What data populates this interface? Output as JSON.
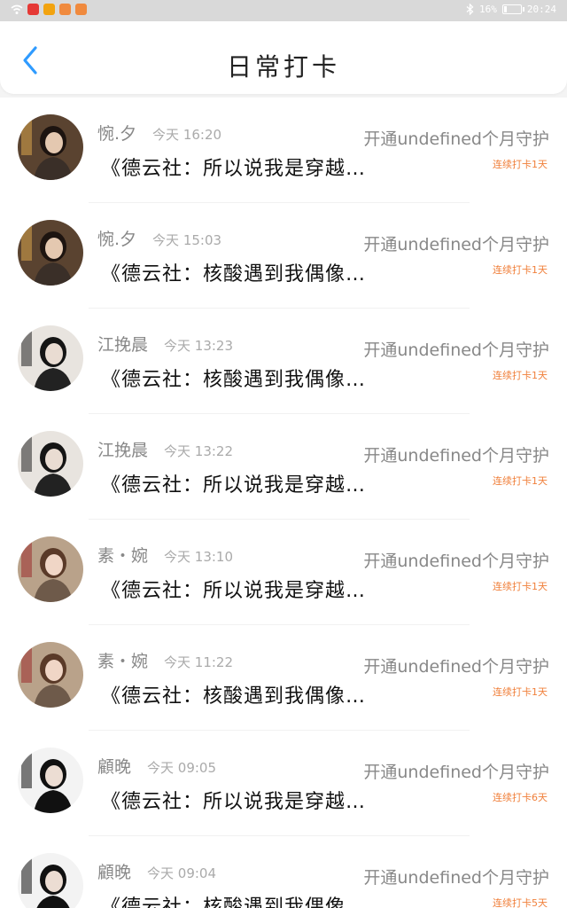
{
  "status_bar": {
    "battery_percent": "16%",
    "battery_level": 0.16,
    "time": "20:24",
    "app_icon_colors": [
      "#e53935",
      "#f2a30f",
      "#f08a3e",
      "#f08a3e"
    ]
  },
  "nav": {
    "back_icon": "chevron-left-icon",
    "title": "日常打卡"
  },
  "records": [
    {
      "name": "惋.夕",
      "time": "今天 16:20",
      "content": "《德云社：所以说我是穿越…",
      "guard": "开通undefined个月守护",
      "streak": "连续打卡1天"
    },
    {
      "name": "惋.夕",
      "time": "今天 15:03",
      "content": "《德云社：核酸遇到我偶像…",
      "guard": "开通undefined个月守护",
      "streak": "连续打卡1天"
    },
    {
      "name": "江挽晨",
      "time": "今天 13:23",
      "content": "《德云社：核酸遇到我偶像…",
      "guard": "开通undefined个月守护",
      "streak": "连续打卡1天"
    },
    {
      "name": "江挽晨",
      "time": "今天 13:22",
      "content": "《德云社：所以说我是穿越…",
      "guard": "开通undefined个月守护",
      "streak": "连续打卡1天"
    },
    {
      "name": "素・婉",
      "time": "今天 13:10",
      "content": "《德云社：所以说我是穿越…",
      "guard": "开通undefined个月守护",
      "streak": "连续打卡1天"
    },
    {
      "name": "素・婉",
      "time": "今天 11:22",
      "content": "《德云社：核酸遇到我偶像…",
      "guard": "开通undefined个月守护",
      "streak": "连续打卡1天"
    },
    {
      "name": "顧晚",
      "time": "今天 09:05",
      "content": "《德云社：所以说我是穿越…",
      "guard": "开通undefined个月守护",
      "streak": "连续打卡6天"
    },
    {
      "name": "顧晚",
      "time": "今天 09:04",
      "content": "《德云社：核酸遇到我偶像…",
      "guard": "开通undefined个月守护",
      "streak": "连续打卡5天"
    }
  ]
}
